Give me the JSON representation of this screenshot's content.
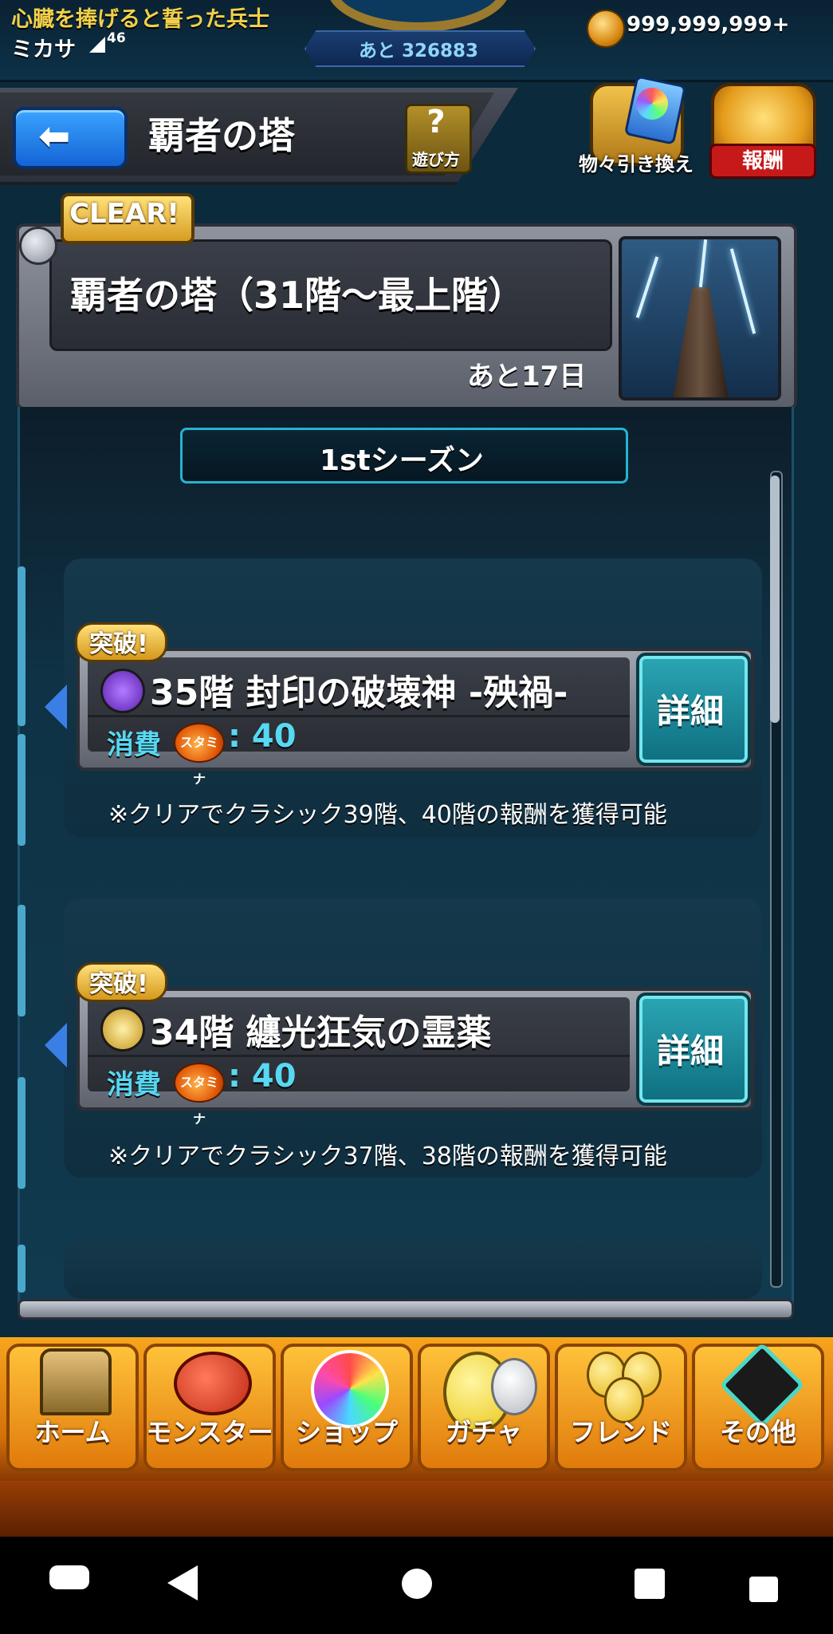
{
  "status": {
    "player_title": "心臓を捧げると誓った兵士",
    "player_name": "ミカサ",
    "player_level": "46",
    "remaining_label": "あと 326883",
    "coins": "999,999,999+"
  },
  "header": {
    "title": "覇者の塔",
    "howto_label": "遊び方",
    "howto_symbol": "?",
    "exchange_label": "物々引き換え",
    "reward_label": "報酬"
  },
  "event": {
    "clear_badge": "CLEAR!",
    "title": "覇者の塔（31階～最上階）",
    "remaining": "あと17日"
  },
  "season": {
    "label": "1stシーズン"
  },
  "floors": [
    {
      "badge": "突破!",
      "name": "35階 封印の破壊神 -殃禍-",
      "element_color": "#7a3ad1",
      "cost_label": "消費",
      "stamina_label": "スタミナ",
      "cost_value": ": 40",
      "detail_label": "詳細",
      "note": "※クリアでクラシック39階、40階の報酬を獲得可能"
    },
    {
      "badge": "突破!",
      "name": "34階 纏光狂気の霊薬",
      "element_color": "#d9b23a",
      "cost_label": "消費",
      "stamina_label": "スタミナ",
      "cost_value": ": 40",
      "detail_label": "詳細",
      "note": "※クリアでクラシック37階、38階の報酬を獲得可能"
    }
  ],
  "nav": [
    {
      "label": "ホーム",
      "icon": "gate-icon"
    },
    {
      "label": "モンスター",
      "icon": "dragon-icon"
    },
    {
      "label": "ショップ",
      "icon": "rainbow-orb-icon"
    },
    {
      "label": "ガチャ",
      "icon": "egg-icon"
    },
    {
      "label": "フレンド",
      "icon": "balloons-icon"
    },
    {
      "label": "その他",
      "icon": "question-diamond-icon"
    }
  ],
  "system": [
    "gamepad-icon",
    "back-icon",
    "home-icon",
    "recents-icon",
    "lock-icon"
  ],
  "colors": {
    "accent_cyan": "#58d8f2",
    "nav_orange": "#f7a51d",
    "badge_gold": "#d69c22"
  }
}
